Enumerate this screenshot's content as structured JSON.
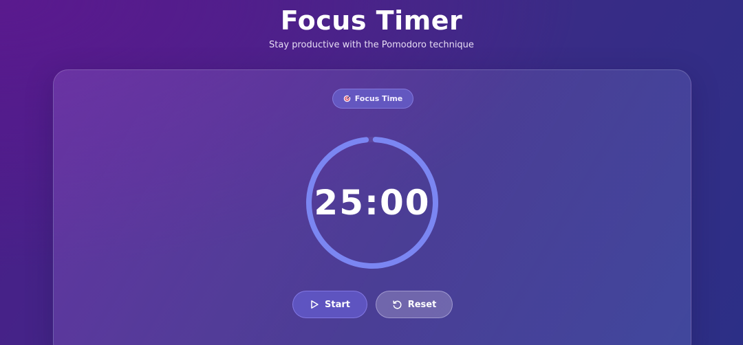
{
  "header": {
    "title": "Focus Timer",
    "subtitle": "Stay productive with the Pomodoro technique"
  },
  "timer": {
    "mode_label": "Focus Time",
    "mode_icon": "target-icon",
    "display": "25:00",
    "progress": 1.0,
    "ring_color": "#7b86f2"
  },
  "controls": {
    "start_label": "Start",
    "start_icon": "play-icon",
    "reset_label": "Reset",
    "reset_icon": "reset-icon"
  }
}
